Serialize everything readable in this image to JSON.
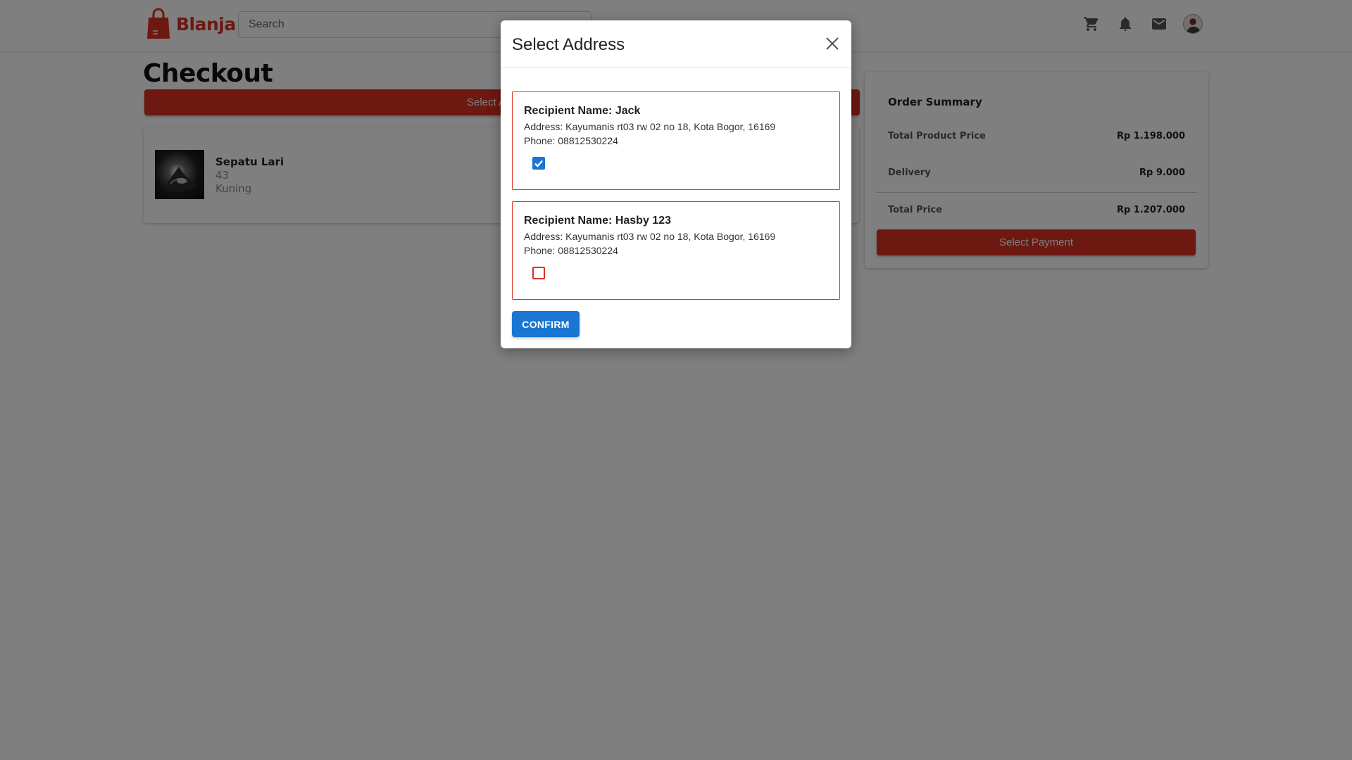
{
  "navbar": {
    "brand": "Blanja",
    "search_placeholder": "Search",
    "icons": [
      "cart-icon",
      "bell-icon",
      "mail-icon",
      "avatar"
    ]
  },
  "page": {
    "title": "Checkout",
    "select_address_label": "Select Address"
  },
  "product": {
    "name": "Sepatu Lari",
    "size": "43",
    "color": "Kuning"
  },
  "summary": {
    "title": "Order Summary",
    "rows": [
      {
        "label": "Total Product Price",
        "value": "Rp 1.198.000"
      },
      {
        "label": "Delivery",
        "value": "Rp 9.000"
      },
      {
        "label": "Total Price",
        "value": "Rp 1.207.000"
      }
    ],
    "payment_label": "Select Payment"
  },
  "modal": {
    "title": "Select Address",
    "addresses": [
      {
        "recipient": "Recipient Name: Jack",
        "address": "Address: Kayumanis rt03 rw 02 no 18, Kota Bogor, 16169",
        "phone": "Phone: 08812530224",
        "selected": true
      },
      {
        "recipient": "Recipient Name: Hasby 123",
        "address": "Address: Kayumanis rt03 rw 02 no 18, Kota Bogor, 16169",
        "phone": "Phone: 08812530224",
        "selected": false
      }
    ],
    "confirm_label": "CONFIRM"
  },
  "colors": {
    "brand_red": "#db3022",
    "primary_blue": "#1976d2",
    "overlay": "rgba(0,0,0,0.5)"
  }
}
